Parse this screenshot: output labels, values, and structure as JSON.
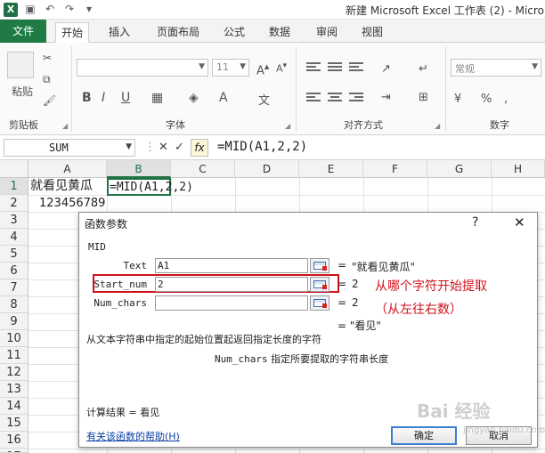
{
  "titlebar": {
    "title": "新建 Microsoft Excel 工作表 (2) - Micro",
    "app_icon": "X"
  },
  "ribbon_tabs": [
    "文件",
    "开始",
    "插入",
    "页面布局",
    "公式",
    "数据",
    "审阅",
    "视图"
  ],
  "ribbon": {
    "clipboard_label": "剪贴板",
    "paste_label": "粘贴",
    "font_label": "字体",
    "font_size": "11",
    "alignment_label": "对齐方式",
    "number_label": "数字",
    "number_format": "常规",
    "bold": "B",
    "italic": "I",
    "underline": "U"
  },
  "formula_bar": {
    "name_box": "SUM",
    "cancel": "✕",
    "enter": "✓",
    "fx": "fx",
    "formula": "=MID(A1,2,2)"
  },
  "sheet": {
    "columns": [
      "A",
      "B",
      "C",
      "D",
      "E",
      "F",
      "G",
      "H"
    ],
    "rows": [
      "1",
      "2",
      "3",
      "4",
      "5",
      "6",
      "7",
      "8",
      "9",
      "10",
      "11",
      "12",
      "13",
      "14",
      "15",
      "16",
      "17"
    ],
    "a1": "就看见黄瓜",
    "b1": "=MID(A1,2,2)",
    "a2": "123456789"
  },
  "dialog": {
    "title": "函数参数",
    "help": "?",
    "close": "✕",
    "function_name": "MID",
    "args": [
      {
        "label": "Text",
        "value": "A1",
        "result": "\"就看见黄瓜\""
      },
      {
        "label": "Start_num",
        "value": "2",
        "result": "2"
      },
      {
        "label": "Num_chars",
        "value": "",
        "result": "2"
      }
    ],
    "formula_result_inline": "= \"看见\"",
    "description": "从文本字符串中指定的起始位置起返回指定长度的字符",
    "arg_description_name": "Num_chars",
    "arg_description": "指定所要提取的字符串长度",
    "result_text": "计算结果 = 看见",
    "help_link": "有关该函数的帮助(H)",
    "ok": "确定",
    "cancel": "取消"
  },
  "annotation": {
    "line1": "从哪个字符开始提取",
    "line2": "（从左往右数）",
    "color": "#d0121b"
  },
  "watermark": {
    "main": "Bai 经验",
    "sub": "jingyan.baidu.com"
  }
}
